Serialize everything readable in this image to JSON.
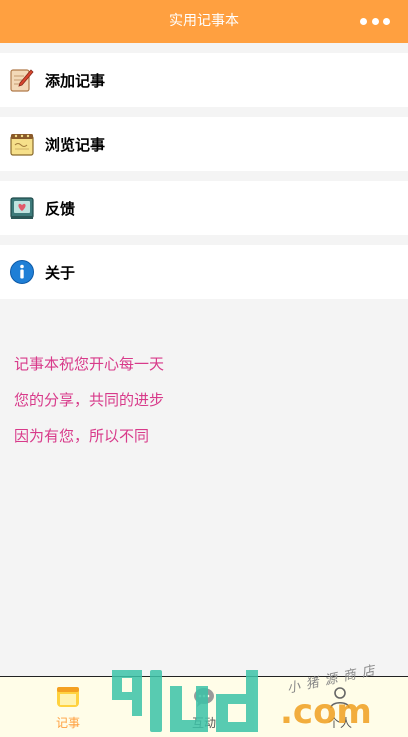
{
  "nav": {
    "title": "实用记事本",
    "more_icon": "more-dots-icon"
  },
  "menu": {
    "items": [
      {
        "label": "添加记事",
        "icon": "edit-note-icon"
      },
      {
        "label": "浏览记事",
        "icon": "notepad-icon"
      },
      {
        "label": "反馈",
        "icon": "feedback-book-icon"
      },
      {
        "label": "关于",
        "icon": "info-icon"
      }
    ]
  },
  "info": {
    "lines": [
      "记事本祝您开心每一天",
      "您的分享，共同的进步",
      "因为有您，所以不同"
    ]
  },
  "tabs": [
    {
      "label": "记事",
      "icon": "notebook-icon",
      "active": true
    },
    {
      "label": "互动",
      "icon": "chat-icon",
      "active": false
    },
    {
      "label": "个人",
      "icon": "person-icon",
      "active": false
    }
  ],
  "watermark": {
    "digits": "91ud",
    "domain": ".com",
    "shop": "小猪源商店"
  },
  "colors": {
    "primary": "#ffa040",
    "info_text": "#d83a8a",
    "tab_active": "#ffa040",
    "tab_inactive": "#555555"
  }
}
